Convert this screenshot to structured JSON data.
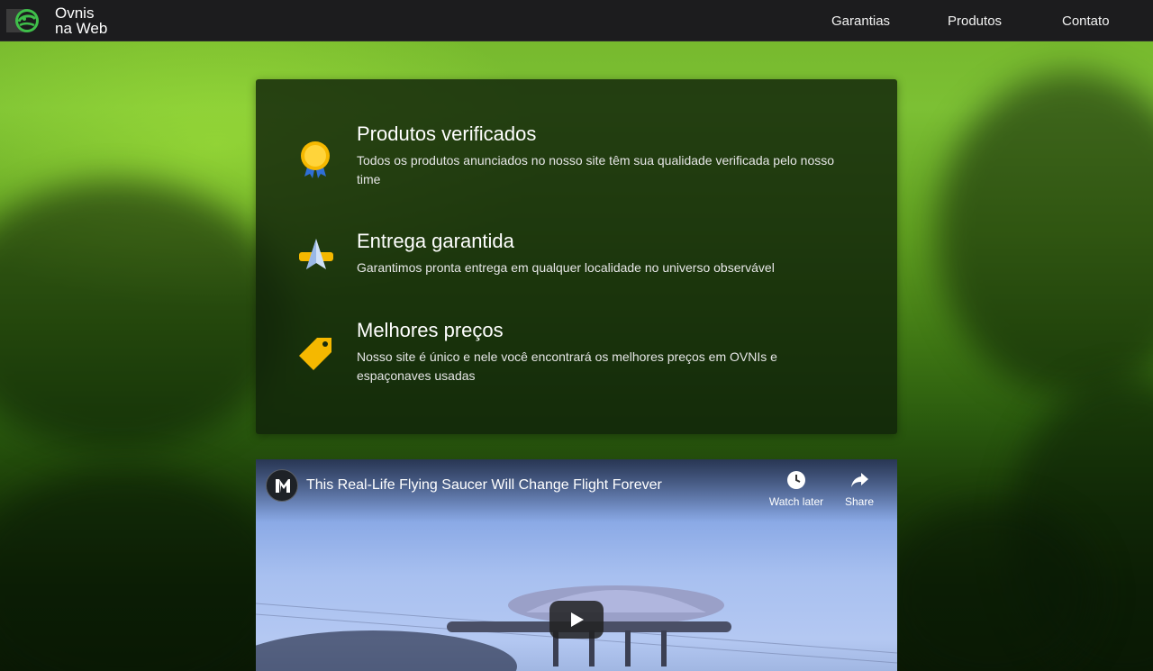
{
  "header": {
    "brand_line1": "Ovnis",
    "brand_line2": "na Web",
    "nav": [
      {
        "label": "Garantias"
      },
      {
        "label": "Produtos"
      },
      {
        "label": "Contato"
      }
    ]
  },
  "features": [
    {
      "icon": "medal-icon",
      "title": "Produtos verificados",
      "text": "Todos os produtos anunciados no nosso site têm sua qualidade verificada pelo nosso time"
    },
    {
      "icon": "rocket-icon",
      "title": "Entrega garantida",
      "text": "Garantimos pronta entrega em qualquer localidade no universo observável"
    },
    {
      "icon": "price-tag-icon",
      "title": "Melhores preços",
      "text": "Nosso site é único e nele você encontrará os melhores preços em OVNIs e espaçonaves usadas"
    }
  ],
  "video": {
    "title": "This Real-Life Flying Saucer Will Change Flight Forever",
    "watch_later": "Watch later",
    "share": "Share"
  },
  "colors": {
    "nav_bg": "#1c1c1e",
    "accent_green": "#3fbf4a",
    "gold": "#f5c518"
  }
}
